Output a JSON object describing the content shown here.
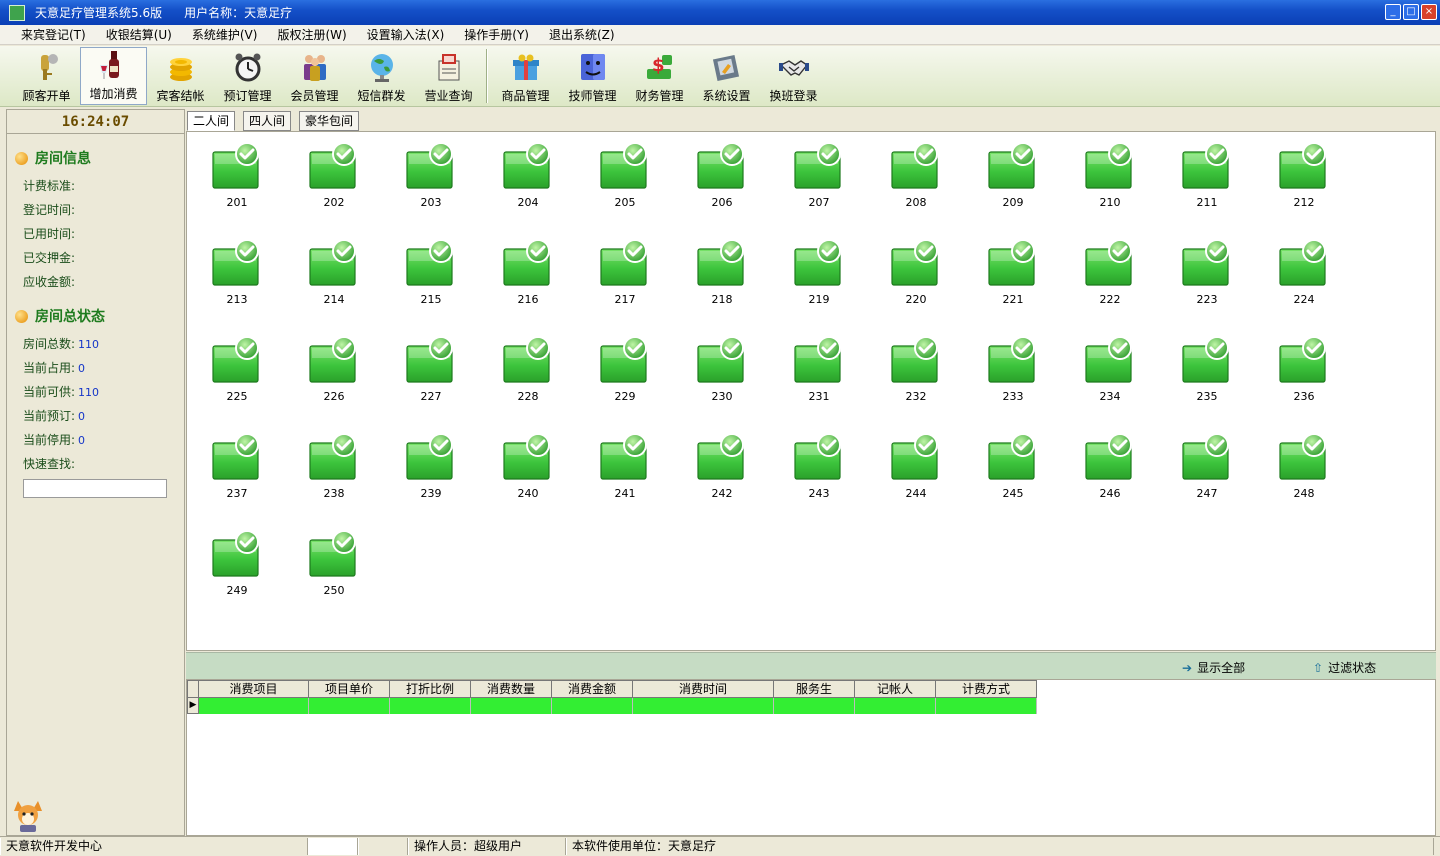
{
  "window": {
    "title": "天意足疗管理系统5.6版",
    "user": "用户名称：天意足疗",
    "buttons": [
      "minimize",
      "maximize",
      "close"
    ]
  },
  "menu": [
    "来宾登记(T)",
    "收银结算(U)",
    "系统维护(V)",
    "版权注册(W)",
    "设置输入法(X)",
    "操作手册(Y)",
    "退出系统(Z)"
  ],
  "toolbar": [
    {
      "label": "顾客开单",
      "icon": "keys-icon"
    },
    {
      "label": "增加消费",
      "icon": "wine-icon",
      "active": true
    },
    {
      "label": "宾客结帐",
      "icon": "coins-icon"
    },
    {
      "label": "预订管理",
      "icon": "alarm-clock-icon"
    },
    {
      "label": "会员管理",
      "icon": "members-icon"
    },
    {
      "label": "短信群发",
      "icon": "satellite-icon"
    },
    {
      "label": "营业查询",
      "icon": "report-icon"
    },
    {
      "label": "商品管理",
      "icon": "gift-icon",
      "group_start": true
    },
    {
      "label": "技师管理",
      "icon": "face-icon"
    },
    {
      "label": "财务管理",
      "icon": "money-icon"
    },
    {
      "label": "系统设置",
      "icon": "settings-icon"
    },
    {
      "label": "换班登录",
      "icon": "handshake-icon"
    }
  ],
  "left_panel": {
    "clock": "16:24:07",
    "room_info_title": "房间信息",
    "room_info_fields": [
      "计费标准:",
      "登记时间:",
      "已用时间:",
      "已交押金:",
      "应收金额:"
    ],
    "status_title": "房间总状态",
    "status_fields": [
      {
        "label": "房间总数:",
        "value": "110"
      },
      {
        "label": "当前占用:",
        "value": "0"
      },
      {
        "label": "当前可供:",
        "value": "110"
      },
      {
        "label": "当前预订:",
        "value": "0"
      },
      {
        "label": "当前停用:",
        "value": "0"
      }
    ],
    "quick_search_label": "快速查找:",
    "quick_search_value": ""
  },
  "tabs": [
    {
      "label": "二人间",
      "selected": true
    },
    {
      "label": "四人间"
    },
    {
      "label": "豪华包间"
    }
  ],
  "rooms": [
    "201",
    "202",
    "203",
    "204",
    "205",
    "206",
    "207",
    "208",
    "209",
    "210",
    "211",
    "212",
    "213",
    "214",
    "215",
    "216",
    "217",
    "218",
    "219",
    "220",
    "221",
    "222",
    "223",
    "224",
    "225",
    "226",
    "227",
    "228",
    "229",
    "230",
    "231",
    "232",
    "233",
    "234",
    "235",
    "236",
    "237",
    "238",
    "239",
    "240",
    "241",
    "242",
    "243",
    "244",
    "245",
    "246",
    "247",
    "248",
    "249",
    "250"
  ],
  "room_status": "available",
  "actions": {
    "show_all": "显示全部",
    "filter_status": "过滤状态"
  },
  "grid": {
    "columns": [
      "消费项目",
      "项目单价",
      "打折比例",
      "消费数量",
      "消费金额",
      "消费时间",
      "服务生",
      "记帐人",
      "计费方式"
    ],
    "rows": [
      [
        "",
        "",
        "",
        "",
        "",
        "",
        "",
        "",
        ""
      ]
    ]
  },
  "status_bar": {
    "developer": "天意软件开发中心",
    "operator": "操作人员：超级用户",
    "unit": "本软件使用单位：天意足疗"
  },
  "colors": {
    "room_available": "#3cc43c",
    "grid_row": "#33ee33",
    "section_title": "#1e7b1e",
    "value_text": "#1536c8"
  }
}
